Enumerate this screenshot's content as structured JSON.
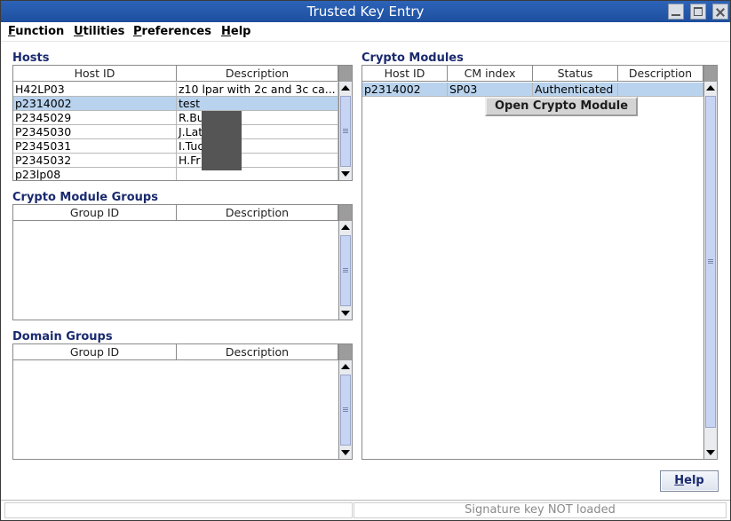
{
  "window": {
    "title": "Trusted Key Entry"
  },
  "menu": [
    {
      "mnemonic": "F",
      "rest": "unction"
    },
    {
      "mnemonic": "U",
      "rest": "tilities"
    },
    {
      "mnemonic": "P",
      "rest": "references"
    },
    {
      "mnemonic": "H",
      "rest": "elp"
    }
  ],
  "hosts": {
    "label": "Hosts",
    "columns": [
      "Host ID",
      "Description"
    ],
    "rows": [
      {
        "host_id": "H42LP03",
        "description": "z10 lpar with 2c and 3c ca..."
      },
      {
        "host_id": "p2314002",
        "description": "test"
      },
      {
        "host_id": "P2345029",
        "description": "R.Bu           n"
      },
      {
        "host_id": "P2345030",
        "description": "J.Lat"
      },
      {
        "host_id": "P2345031",
        "description": "I.Tuc           er"
      },
      {
        "host_id": "P2345032",
        "description": "H.Fr           erger"
      },
      {
        "host_id": "p23lp08",
        "description": ""
      }
    ],
    "selected_index": 1
  },
  "crypto_module_groups": {
    "label": "Crypto Module Groups",
    "columns": [
      "Group ID",
      "Description"
    ]
  },
  "domain_groups": {
    "label": "Domain Groups",
    "columns": [
      "Group ID",
      "Description"
    ]
  },
  "crypto_modules": {
    "label": "Crypto Modules",
    "columns": [
      "Host ID",
      "CM index",
      "Status",
      "Description"
    ],
    "rows": [
      {
        "host_id": "p2314002",
        "cm_index": "SP03",
        "status": "Authenticated",
        "description": ""
      }
    ]
  },
  "context_menu": {
    "item": "Open Crypto Module"
  },
  "help_button": {
    "mnemonic": "H",
    "rest": "elp"
  },
  "status": {
    "left": "",
    "right": "Signature key NOT loaded"
  }
}
